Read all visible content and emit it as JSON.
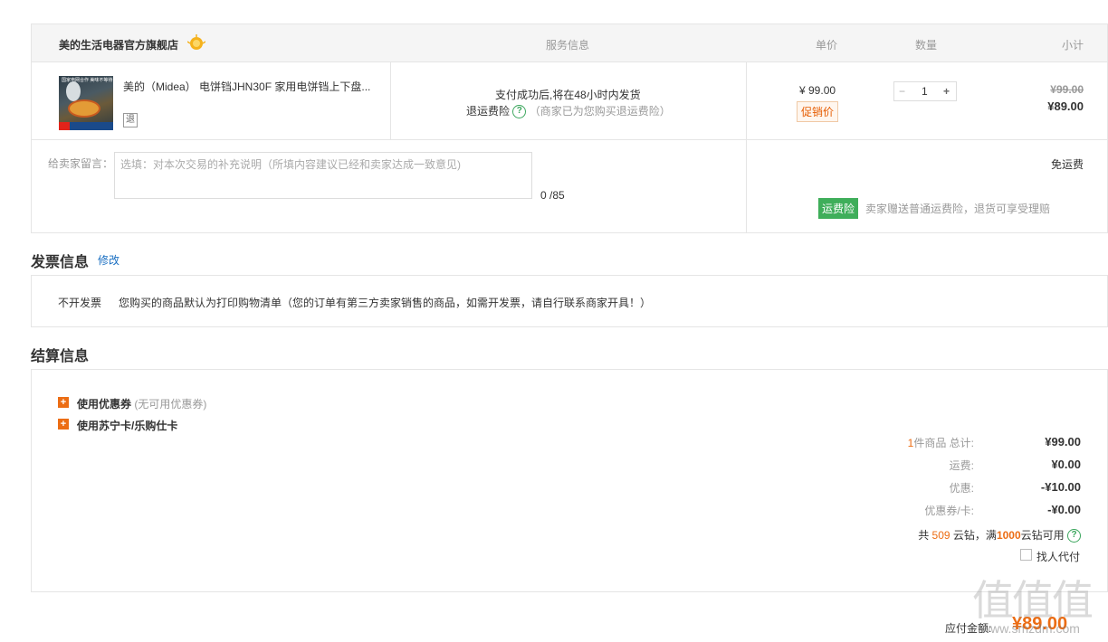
{
  "order": {
    "shop_name": "美的生活电器官方旗舰店",
    "columns": {
      "service": "服务信息",
      "unit_price": "单价",
      "quantity": "数量",
      "subtotal": "小计"
    },
    "item": {
      "title": "美的（Midea） 电饼铛JHN30F 家用电饼铛上下盘...",
      "return_badge": "退",
      "thumb_text": "国家电网合作\n美味不等待",
      "thumb_bottom": "8 拍下立减10元",
      "service_line1": "支付成功后,将在48小时内发货",
      "service_insurance": "退运费险",
      "service_insurance_note": "（商家已为您购买退运费险）",
      "unit_price": "¥ 99.00",
      "promo_tag": "促销价",
      "quantity": "1",
      "minus": "−",
      "plus": "+",
      "original_subtotal": "¥99.00",
      "subtotal": "¥89.00"
    },
    "message": {
      "label": "给卖家留言：",
      "placeholder": "选填：对本次交易的补充说明（所填内容建议已经和卖家达成一致意见)",
      "count": "0 /85"
    },
    "shipping": {
      "free": "免运费",
      "insurance_tag": "运费险",
      "insurance_note": "卖家赠送普通运费险，退货可享受理赔"
    }
  },
  "invoice": {
    "title": "发票信息",
    "edit": "修改",
    "type": "不开发票",
    "note": "您购买的商品默认为打印购物清单（您的订单有第三方卖家销售的商品，如需开发票，请自行联系商家开具！）"
  },
  "settlement": {
    "title": "结算信息",
    "coupon_label": "使用优惠券",
    "coupon_note": "(无可用优惠券)",
    "card_label": "使用苏宁卡/乐购仕卡",
    "summary": {
      "count_prefix": "1",
      "count_label": "件商品 总计:",
      "total": "¥99.00",
      "shipping_label": "运费:",
      "shipping": "¥0.00",
      "discount_label": "优惠:",
      "discount": "-¥10.00",
      "coupon_label": "优惠券/卡:",
      "coupon": "-¥0.00",
      "diamond_prefix": "共",
      "diamond_count": "509",
      "diamond_mid": "云钻，满",
      "diamond_threshold": "1000",
      "diamond_suffix": "云钻可用",
      "proxy_pay": "找人代付"
    },
    "payable_label": "应付金额:",
    "payable": "¥89.00"
  },
  "watermark": "值值值",
  "watermark_sub": "www.smzdm.com",
  "colors": {
    "accent_orange": "#ec6d14",
    "green": "#3fae5a",
    "link_blue": "#1a6fc2"
  }
}
